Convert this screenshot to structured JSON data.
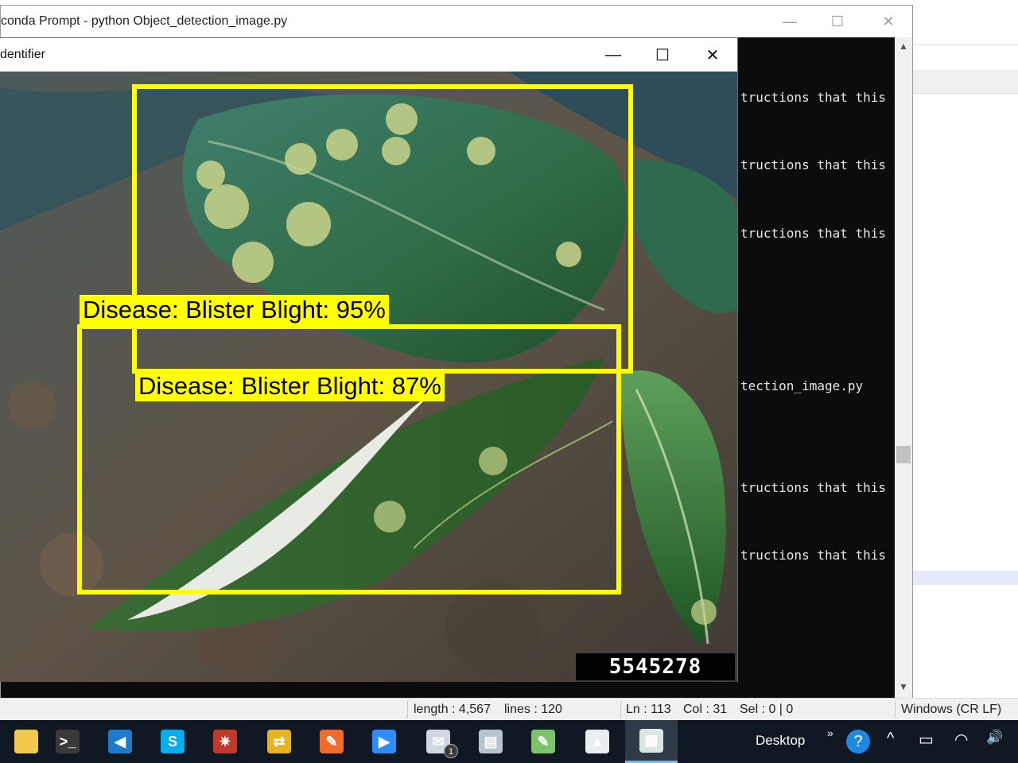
{
  "console_window": {
    "title": "conda Prompt - python  Object_detection_image.py",
    "minimize_glyph": "—",
    "maximize_glyph": "☐",
    "close_glyph": "✕",
    "lines": [
      "tructions that this",
      "tructions that this",
      "tructions that this",
      "tection_image.py",
      "tructions that this",
      "tructions that this"
    ],
    "scroll_up_glyph": "▲",
    "scroll_down_glyph": "▼"
  },
  "detection_window": {
    "title": "dentifier",
    "minimize_glyph": "—",
    "maximize_glyph": "☐",
    "close_glyph": "✕",
    "detections": [
      {
        "label": "Disease: Blister Blight: 95%"
      },
      {
        "label": "Disease: Blister Blight: 87%"
      }
    ],
    "image_id": "5545278"
  },
  "status_bar": {
    "length": "length : 4,567",
    "lines": "lines : 120",
    "ln": "Ln : 113",
    "col": "Col : 31",
    "sel": "Sel : 0 | 0",
    "eol": "Windows (CR LF)"
  },
  "taskbar": {
    "apps": [
      {
        "name": "file-explorer-icon",
        "glyph": "",
        "color": "#f2c94c"
      },
      {
        "name": "command-prompt-icon",
        "glyph": ">_",
        "color": "#3a3a3a"
      },
      {
        "name": "visual-studio-code-icon",
        "glyph": "◀",
        "color": "#1f7acb"
      },
      {
        "name": "skype-icon",
        "glyph": "S",
        "color": "#00aff0"
      },
      {
        "name": "spider-web-app-icon",
        "glyph": "✷",
        "color": "#c0392b"
      },
      {
        "name": "network-app-icon",
        "glyph": "⇄",
        "color": "#e6b422"
      },
      {
        "name": "pen-app-icon",
        "glyph": "✎",
        "color": "#f06a2a"
      },
      {
        "name": "zoom-icon",
        "glyph": "▶",
        "color": "#2d8cff"
      },
      {
        "name": "mail-icon",
        "glyph": "✉",
        "color": "#cfd8e0",
        "badge": "1"
      },
      {
        "name": "printer-app-icon",
        "glyph": "▤",
        "color": "#b8c4cc"
      },
      {
        "name": "notepad-app-icon",
        "glyph": "✎",
        "color": "#7cc36a"
      },
      {
        "name": "photos-icon",
        "glyph": "▲",
        "color": "#e9eef2"
      },
      {
        "name": "image-viewer-icon",
        "glyph": "▦",
        "color": "#d9e7e0"
      }
    ],
    "desktop_label": "Desktop",
    "more_glyph": "»",
    "help_glyph": "?",
    "chevron_glyph": "^",
    "battery_glyph": "▭",
    "wifi_glyph": "◠",
    "volume_glyph": "🔊"
  }
}
